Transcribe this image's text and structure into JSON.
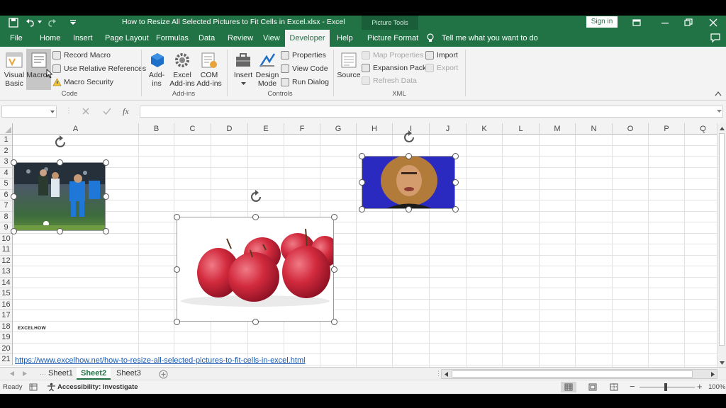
{
  "titlebar": {
    "doc_title": "How to Resize All Selected Pictures to Fit Cells in Excel.xlsx  -  Excel",
    "context_tab_group": "Picture Tools",
    "sign_in": "Sign in"
  },
  "tabs": [
    {
      "label": "File"
    },
    {
      "label": "Home"
    },
    {
      "label": "Insert"
    },
    {
      "label": "Page Layout"
    },
    {
      "label": "Formulas"
    },
    {
      "label": "Data"
    },
    {
      "label": "Review"
    },
    {
      "label": "View"
    },
    {
      "label": "Developer"
    },
    {
      "label": "Help"
    },
    {
      "label": "Picture Format"
    }
  ],
  "tell_me": "Tell me what you want to do",
  "ribbon": {
    "code": {
      "visual_basic": "Visual Basic",
      "macros": "Macros",
      "record_macro": "Record Macro",
      "relative_refs": "Use Relative References",
      "macro_security": "Macro Security",
      "group_label": "Code"
    },
    "addins": {
      "addins": "Add-ins",
      "excel_addins": "Excel Add-ins",
      "com_addins": "COM Add-ins",
      "group_label": "Add-ins"
    },
    "controls": {
      "insert": "Insert",
      "design_mode": "Design Mode",
      "properties": "Properties",
      "view_code": "View Code",
      "run_dialog": "Run Dialog",
      "group_label": "Controls"
    },
    "xml": {
      "source": "Source",
      "map_properties": "Map Properties",
      "expansion_packs": "Expansion Packs",
      "refresh_data": "Refresh Data",
      "import": "Import",
      "export": "Export",
      "group_label": "XML"
    }
  },
  "formula_bar": {
    "name_box": "",
    "formula": "",
    "fx": "fx"
  },
  "columns": [
    "A",
    "B",
    "C",
    "D",
    "E",
    "F",
    "G",
    "H",
    "I",
    "J",
    "K",
    "L",
    "M",
    "N",
    "O",
    "P",
    "Q"
  ],
  "rows": [
    "1",
    "2",
    "3",
    "4",
    "5",
    "6",
    "7",
    "8",
    "9",
    "10",
    "11",
    "12",
    "13",
    "14",
    "15",
    "16",
    "17",
    "18",
    "19",
    "20",
    "21"
  ],
  "cells": {
    "a18": "EXCELHOW",
    "a21": "https://www.excelhow.net/how-to-resize-all-selected-pictures-to-fit-cells-in-excel.html"
  },
  "sheets": [
    {
      "label": "Sheet1",
      "active": false
    },
    {
      "label": "Sheet2",
      "active": true
    },
    {
      "label": "Sheet3",
      "active": false
    }
  ],
  "status": {
    "ready": "Ready",
    "accessibility": "Accessibility: Investigate",
    "zoom": "100%"
  },
  "colors": {
    "excel_green": "#217346",
    "link": "#1a5bb0"
  }
}
